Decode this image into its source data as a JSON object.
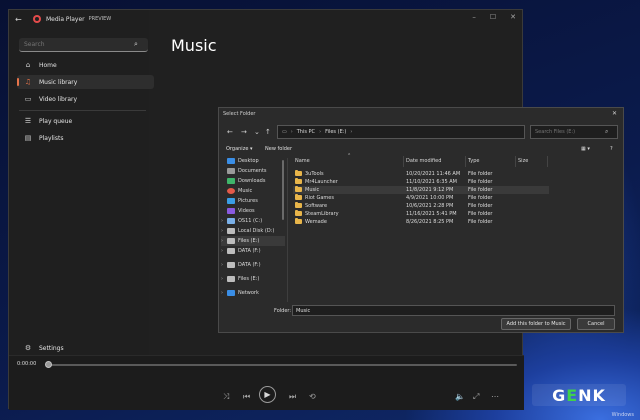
{
  "player": {
    "app_title": "Media Player",
    "preview_badge": "PREVIEW",
    "search_placeholder": "Search",
    "nav": [
      {
        "label": "Home",
        "icon": "home-icon"
      },
      {
        "label": "Music library",
        "icon": "music-icon",
        "active": true
      },
      {
        "label": "Video library",
        "icon": "video-icon"
      },
      {
        "label": "Play queue",
        "icon": "queue-icon"
      },
      {
        "label": "Playlists",
        "icon": "playlist-icon"
      }
    ],
    "settings_label": "Settings",
    "page_title": "Music",
    "time": "0:00:00",
    "progress": 0,
    "accent_color": "#e8744a"
  },
  "dialog": {
    "title": "Select Folder",
    "address": [
      "This PC",
      "Files (E:)"
    ],
    "search_placeholder": "Search Files (E:)",
    "organize_label": "Organize ▾",
    "new_folder_label": "New folder",
    "tree": [
      {
        "label": "Desktop",
        "color": "#3a8ee6"
      },
      {
        "label": "Documents",
        "color": "#9a9a9a"
      },
      {
        "label": "Downloads",
        "color": "#3fb56a"
      },
      {
        "label": "Music",
        "color": "#e35a4a"
      },
      {
        "label": "Pictures",
        "color": "#3a9ee6"
      },
      {
        "label": "Videos",
        "color": "#8a5ae0"
      },
      {
        "label": "OS11 (C:)",
        "color": "#7ab0e8"
      },
      {
        "label": "Local Disk (D:)",
        "color": "#bdbdbd"
      },
      {
        "label": "Files (E:)",
        "color": "#bdbdbd",
        "selected": true
      },
      {
        "label": "DATA (F:)",
        "color": "#bdbdbd"
      },
      {
        "label": "DATA (F:)",
        "color": "#bdbdbd"
      },
      {
        "label": "Files (E:)",
        "color": "#bdbdbd"
      },
      {
        "label": "Network",
        "color": "#3a8ee6"
      }
    ],
    "columns": {
      "name": "Name",
      "date": "Date modified",
      "type": "Type",
      "size": "Size"
    },
    "files": [
      {
        "name": "3uTools",
        "date": "10/20/2021 11:46 AM",
        "type": "File folder"
      },
      {
        "name": "Mr4Launcher",
        "date": "11/10/2021 6:35 AM",
        "type": "File folder"
      },
      {
        "name": "Music",
        "date": "11/8/2021 9:12 PM",
        "type": "File folder",
        "selected": true
      },
      {
        "name": "Riot Games",
        "date": "4/9/2021 10:00 PM",
        "type": "File folder"
      },
      {
        "name": "Software",
        "date": "10/6/2021 2:28 PM",
        "type": "File folder"
      },
      {
        "name": "SteamLibrary",
        "date": "11/16/2021 5:41 PM",
        "type": "File folder"
      },
      {
        "name": "Wemade",
        "date": "8/26/2021 8:25 PM",
        "type": "File folder"
      }
    ],
    "folder_label": "Folder:",
    "folder_value": "Music",
    "add_button": "Add this folder to Music",
    "cancel_button": "Cancel"
  },
  "desktop": {
    "watermark": "GENK",
    "watermark_tail": "NK",
    "windows_label": "Windows"
  }
}
